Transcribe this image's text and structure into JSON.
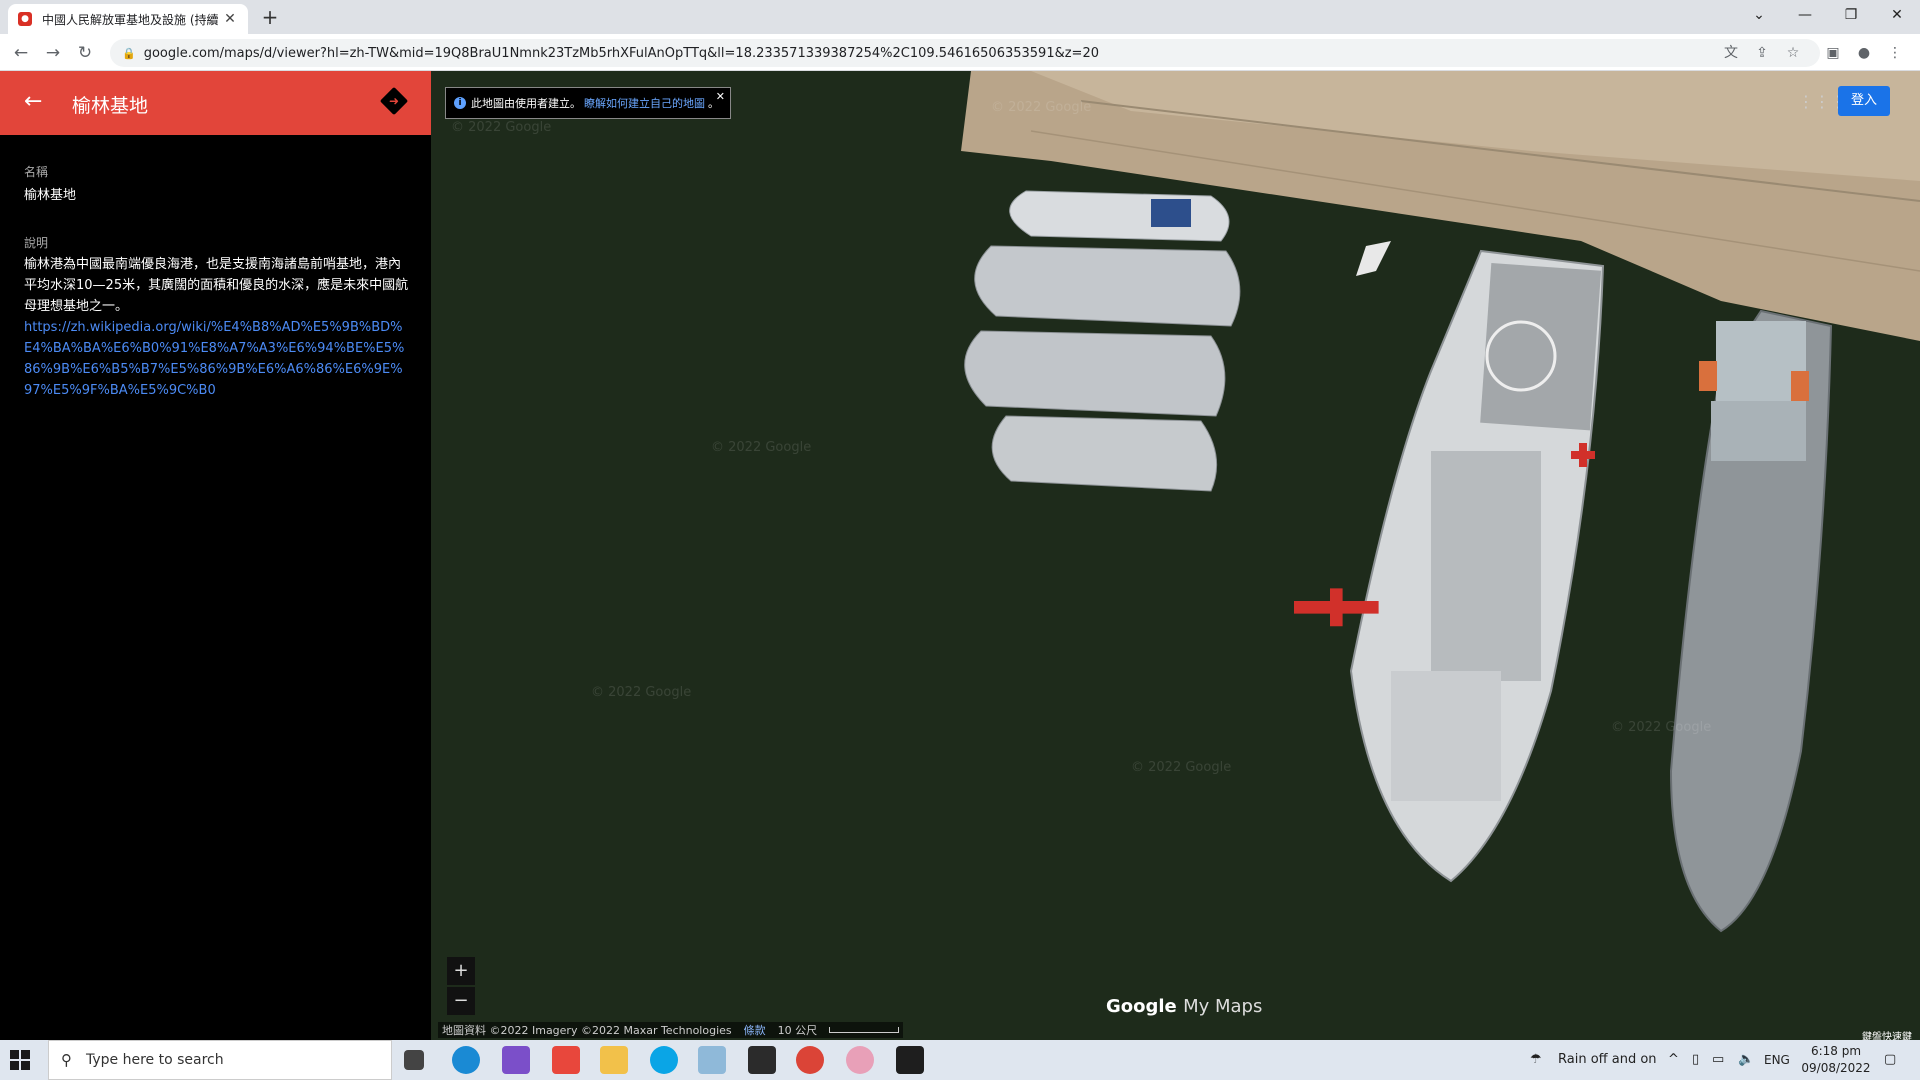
{
  "browser": {
    "tab_title": "中國人民解放軍基地及設施 (持續",
    "url": "google.com/maps/d/viewer?hl=zh-TW&mid=19Q8BraU1Nmnk23TzMb5rhXFulAnOpTTq&ll=18.233571339387254%2C109.54616506353591&z=20"
  },
  "sidebar": {
    "title": "榆林基地",
    "name_label": "名稱",
    "name_value": "榆林基地",
    "desc_label": "說明",
    "desc_text": "榆林港為中國最南端優良海港，也是支援南海諸島前哨基地，港內平均水深10—25米，其廣闊的面積和優良的水深，應是未來中國航母理想基地之一。",
    "desc_link": "https://zh.wikipedia.org/wiki/%E4%B8%AD%E5%9B%BD%E4%BA%BA%E6%B0%91%E8%A7%A3%E6%94%BE%E5%86%9B%E6%B5%B7%E5%86%9B%E6%A6%86%E6%9E%97%E5%9F%BA%E5%9C%B0"
  },
  "map": {
    "banner_text": "此地圖由使用者建立。",
    "banner_link": "瞭解如何建立自己的地圖",
    "banner_end": "。",
    "signin": "登入",
    "zoom_in": "+",
    "zoom_out": "−",
    "logo_google": "Google",
    "logo_mymaps": "My Maps",
    "attribution": "地圖資料 ©2022 Imagery ©2022 Maxar Technologies",
    "terms": "條款",
    "scale": "10 公尺",
    "shortcuts": "鍵盤快速鍵",
    "watermark": "© 2022 Google"
  },
  "taskbar": {
    "search_placeholder": "Type here to search",
    "weather": "Rain off and on",
    "lang": "ENG",
    "time": "6:18 pm",
    "date": "09/08/2022"
  },
  "colors": {
    "sidebar_header": "#e2453a",
    "link": "#4c8bf5",
    "signin": "#1a73e8"
  }
}
